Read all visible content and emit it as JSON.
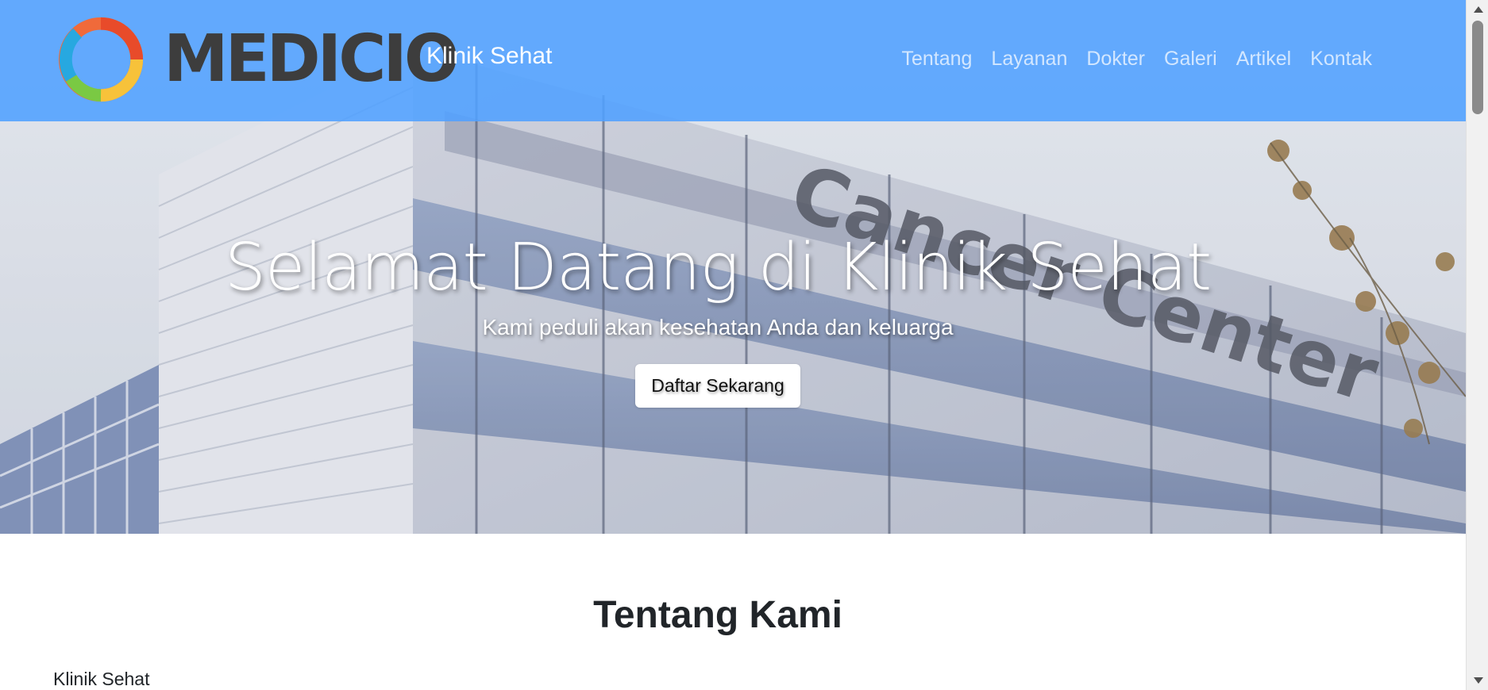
{
  "navbar": {
    "logo_wordmark": "MEDICIO",
    "brand_name": "Klinik Sehat",
    "links": [
      "Tentang",
      "Layanan",
      "Dokter",
      "Galeri",
      "Artikel",
      "Kontak"
    ]
  },
  "hero": {
    "title": "Selamat Datang di Klinik Sehat",
    "subtitle": "Kami peduli akan kesehatan Anda dan keluarga",
    "cta_label": "Daftar Sekarang",
    "background_sign_text": "Cancer Center"
  },
  "about": {
    "heading": "Tentang Kami",
    "text": "Klinik Sehat"
  },
  "colors": {
    "navbar_bg": "#50a0ff",
    "logo_text": "#3d3d3d",
    "button_bg": "#ffffff"
  },
  "icons": {
    "logo_mark": "medicio-ring-logo"
  }
}
